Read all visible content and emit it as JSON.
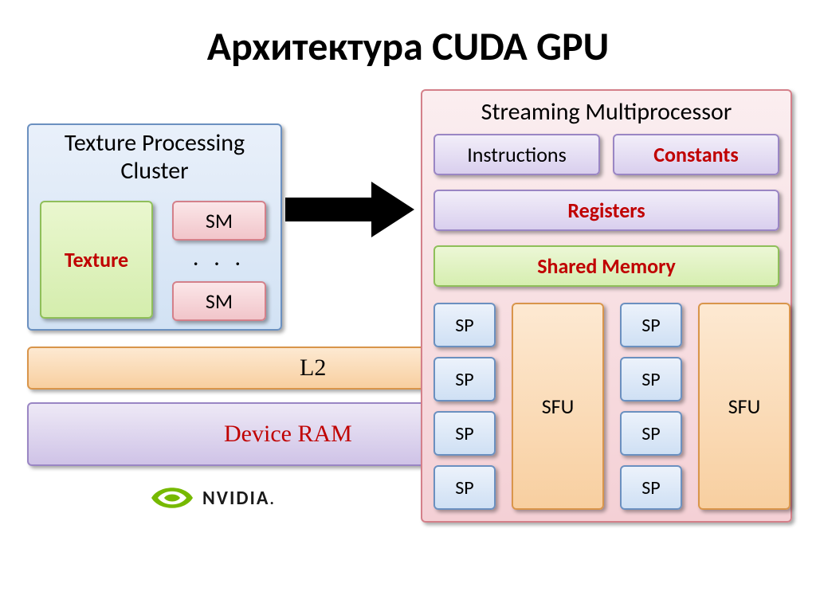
{
  "title": "Архитектура CUDA GPU",
  "tpc": {
    "title": "Texture Processing Cluster",
    "texture": "Texture",
    "sm": "SM",
    "dots": ". . ."
  },
  "bars": {
    "l2": "L2",
    "dram": "Device RAM"
  },
  "logo": {
    "text": "NVIDIA"
  },
  "smp": {
    "title": "Streaming Multiprocessor",
    "instructions": "Instructions",
    "constants": "Constants",
    "registers": "Registers",
    "shared": "Shared Memory",
    "sp": "SP",
    "sfu": "SFU"
  }
}
